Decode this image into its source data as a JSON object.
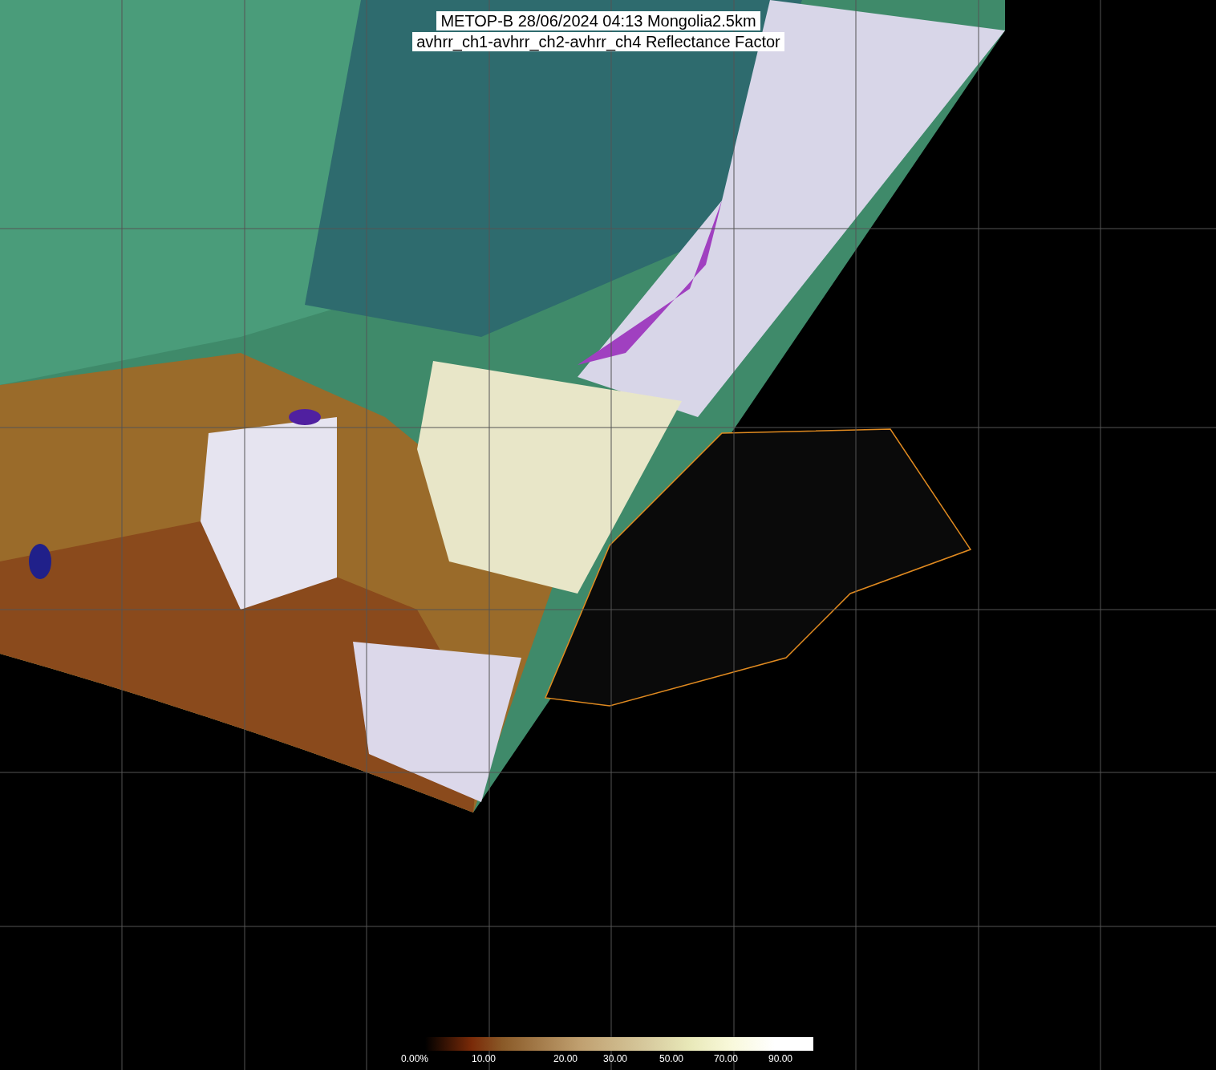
{
  "title": {
    "lines": [
      "METOP-B 28/06/2024 04:13 Mongolia2.5km",
      "avhrr_ch1-avhrr_ch2-avhrr_ch4 Reflectance Factor"
    ]
  },
  "legend": {
    "labels": [
      "0.00%",
      "10.00",
      "20.00",
      "30.00",
      "50.00",
      "70.00",
      "90.00"
    ]
  }
}
